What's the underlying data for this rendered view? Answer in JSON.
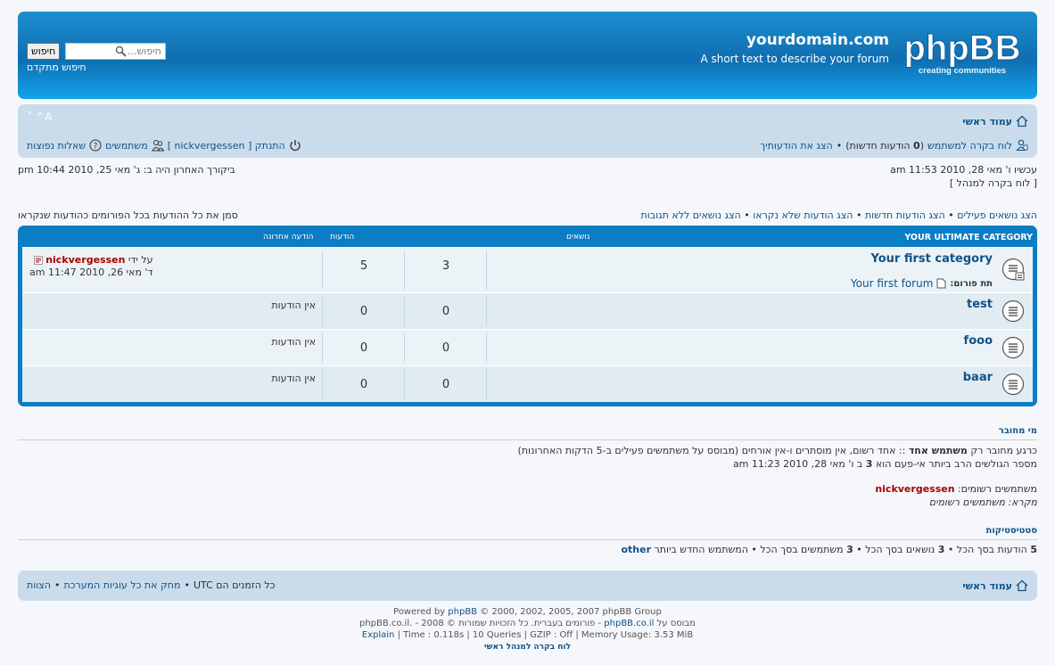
{
  "header": {
    "site_title": "yourdomain.com",
    "site_desc": "A short text to describe your forum",
    "logo_text": "phpBB",
    "logo_tagline": "creating communities",
    "search_placeholder": "חיפוש...",
    "search_button": "חיפוש",
    "advanced_search": "חיפוש מתקדם"
  },
  "navbar": {
    "home": "עמוד ראשי",
    "font_toggle": "A^",
    "ucp": "לוח בקרה למשתמש",
    "new_msgs_open": "(",
    "new_msgs_count": "0",
    "new_msgs_text": "הודעות חדשות)",
    "sep": "•",
    "view_posts": "הצג את הודעותיך",
    "faq": "שאלות נפוצות",
    "members": "משתמשים",
    "logout_pre": "התנתק [",
    "logout_user": "nickvergessen",
    "logout_post": "]"
  },
  "info": {
    "last_visit": "ביקורך האחרון היה ב: ג' מאי 25, 2010 10:44 pm",
    "current_time": "עכשיו ו' מאי 28, 2010 11:53 am",
    "acp_link": "[ לוח בקרה למנהל ]",
    "mark_read": "סמן את כל ההודעות בכל הפורומים כהודעות שנקראו",
    "search_links": [
      "הצג נושאים ללא תגובות",
      "הצג הודעות שלא נקראו",
      "הצג הודעות חדשות",
      "הצג נושאים פעילים"
    ],
    "link_sep": "•"
  },
  "forumlist": {
    "category": "YOUR ULTIMATE CATEGORY",
    "col_topics": "נושאים",
    "col_posts": "הודעות",
    "col_lastpost": "הודעה אחרונה",
    "rows": [
      {
        "name": "Your first category",
        "topics": "3",
        "posts": "5",
        "subforum_label": "תת פורום:",
        "subforum": "Your first forum",
        "last_by": "על ידי",
        "last_user": "nickvergessen",
        "last_date": "ד' מאי 26, 2010 11:47 am"
      },
      {
        "name": "test",
        "topics": "0",
        "posts": "0",
        "last": "אין הודעות"
      },
      {
        "name": "fooo",
        "topics": "0",
        "posts": "0",
        "last": "אין הודעות"
      },
      {
        "name": "baar",
        "topics": "0",
        "posts": "0",
        "last": "אין הודעות"
      }
    ]
  },
  "online": {
    "title": "מי מחובר",
    "line1_pre": "כרגע מחובר רק",
    "line1_bold": "משתמש אחד",
    "line1_post": ":: אחד רשום, אין מוסתרים ו-אין אורחים (מבוסס על משתמשים פעילים ב-5 הדקות האחרונות)",
    "line2_pre": "מספר הגולשים הרב ביותר אי-פעם הוא",
    "line2_num": "3",
    "line2_post": "ב ו' מאי 28, 2010 11:23 am",
    "registered_label": "משתמשים רשומים:",
    "registered_user": "nickvergessen",
    "legend": "מקרא: משתמשים רשומים"
  },
  "stats": {
    "title": "סטטיסטיקות",
    "posts_num": "5",
    "posts_text": "הודעות בסך הכל",
    "topics_num": "3",
    "topics_text": "נושאים בסך הכל",
    "users_num": "3",
    "users_text": "משתמשים בסך הכל",
    "newest_text": "המשתמש החדש ביותר",
    "newest_user": "other",
    "sep": "•"
  },
  "footer_nav": {
    "home": "עמוד ראשי",
    "team": "הצוות",
    "delete_cookies": "מחק את כל עוגיות המערכת",
    "timezone": "כל הזמנים הם UTC",
    "sep": "•"
  },
  "copyright": {
    "line1_pre": "Powered by",
    "line1_link": "phpBB",
    "line1_post": "© 2000, 2002, 2005, 2007 phpBB Group",
    "line2_a": "מבוסס על",
    "line2_link": "phpBB.co.il",
    "line2_b": "- פורומים בעברית. כל הזכויות שמורות © 2008 - .phpBB.co.il",
    "line3_link": "Explain",
    "line3_text": "| Time : 0.118s | 10 Queries | GZIP : Off | Memory Usage: 3.53 MiB",
    "line4": "לוח בקרה למנהל ראשי"
  }
}
